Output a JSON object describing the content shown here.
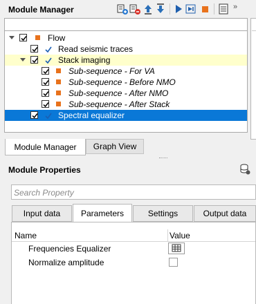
{
  "module_manager": {
    "title": "Module Manager",
    "toolbar_icons": [
      "add-module-icon",
      "remove-module-icon",
      "move-up-icon",
      "move-down-icon",
      "run-icon",
      "run-step-icon",
      "stop-icon",
      "log-icon"
    ],
    "tree": [
      {
        "label": "Flow",
        "level": 0,
        "marker": "orange-square",
        "checked": true,
        "expanded": true,
        "italic": false,
        "highlight": "none"
      },
      {
        "label": "Read seismic traces",
        "level": 1,
        "marker": "blue-check",
        "checked": true,
        "italic": false,
        "highlight": "none"
      },
      {
        "label": "Stack imaging",
        "level": 1,
        "marker": "blue-check",
        "checked": true,
        "expanded": true,
        "italic": false,
        "highlight": "yellow"
      },
      {
        "label": "Sub-sequence - For VA",
        "level": 2,
        "marker": "orange-square",
        "checked": true,
        "italic": true,
        "highlight": "none"
      },
      {
        "label": "Sub-sequence - Before NMO",
        "level": 2,
        "marker": "orange-square",
        "checked": true,
        "italic": true,
        "highlight": "none"
      },
      {
        "label": "Sub-sequence - After NMO",
        "level": 2,
        "marker": "orange-square",
        "checked": true,
        "italic": true,
        "highlight": "none"
      },
      {
        "label": "Sub-sequence - After Stack",
        "level": 2,
        "marker": "orange-square",
        "checked": true,
        "italic": true,
        "highlight": "none"
      },
      {
        "label": "Spectral equalizer",
        "level": 1,
        "marker": "blue-check",
        "checked": true,
        "italic": false,
        "highlight": "selected"
      }
    ],
    "bottom_tabs": [
      "Module Manager",
      "Graph View"
    ],
    "active_bottom_tab": "Module Manager"
  },
  "module_properties": {
    "title": "Module Properties",
    "search_placeholder": "Search Property",
    "tabs": [
      "Input data",
      "Parameters",
      "Settings",
      "Output data"
    ],
    "active_tab": "Parameters",
    "columns": [
      "Name",
      "Value"
    ],
    "properties": [
      {
        "name": "Frequencies Equalizer",
        "value_type": "table-editor-icon"
      },
      {
        "name": "Normalize amplitude",
        "value_type": "checkbox",
        "checked": false
      }
    ]
  },
  "colors": {
    "selection": "#0a78d7",
    "highlight": "#ffffcc",
    "accent_orange": "#e8721c",
    "check_blue": "#1a5fb4"
  }
}
